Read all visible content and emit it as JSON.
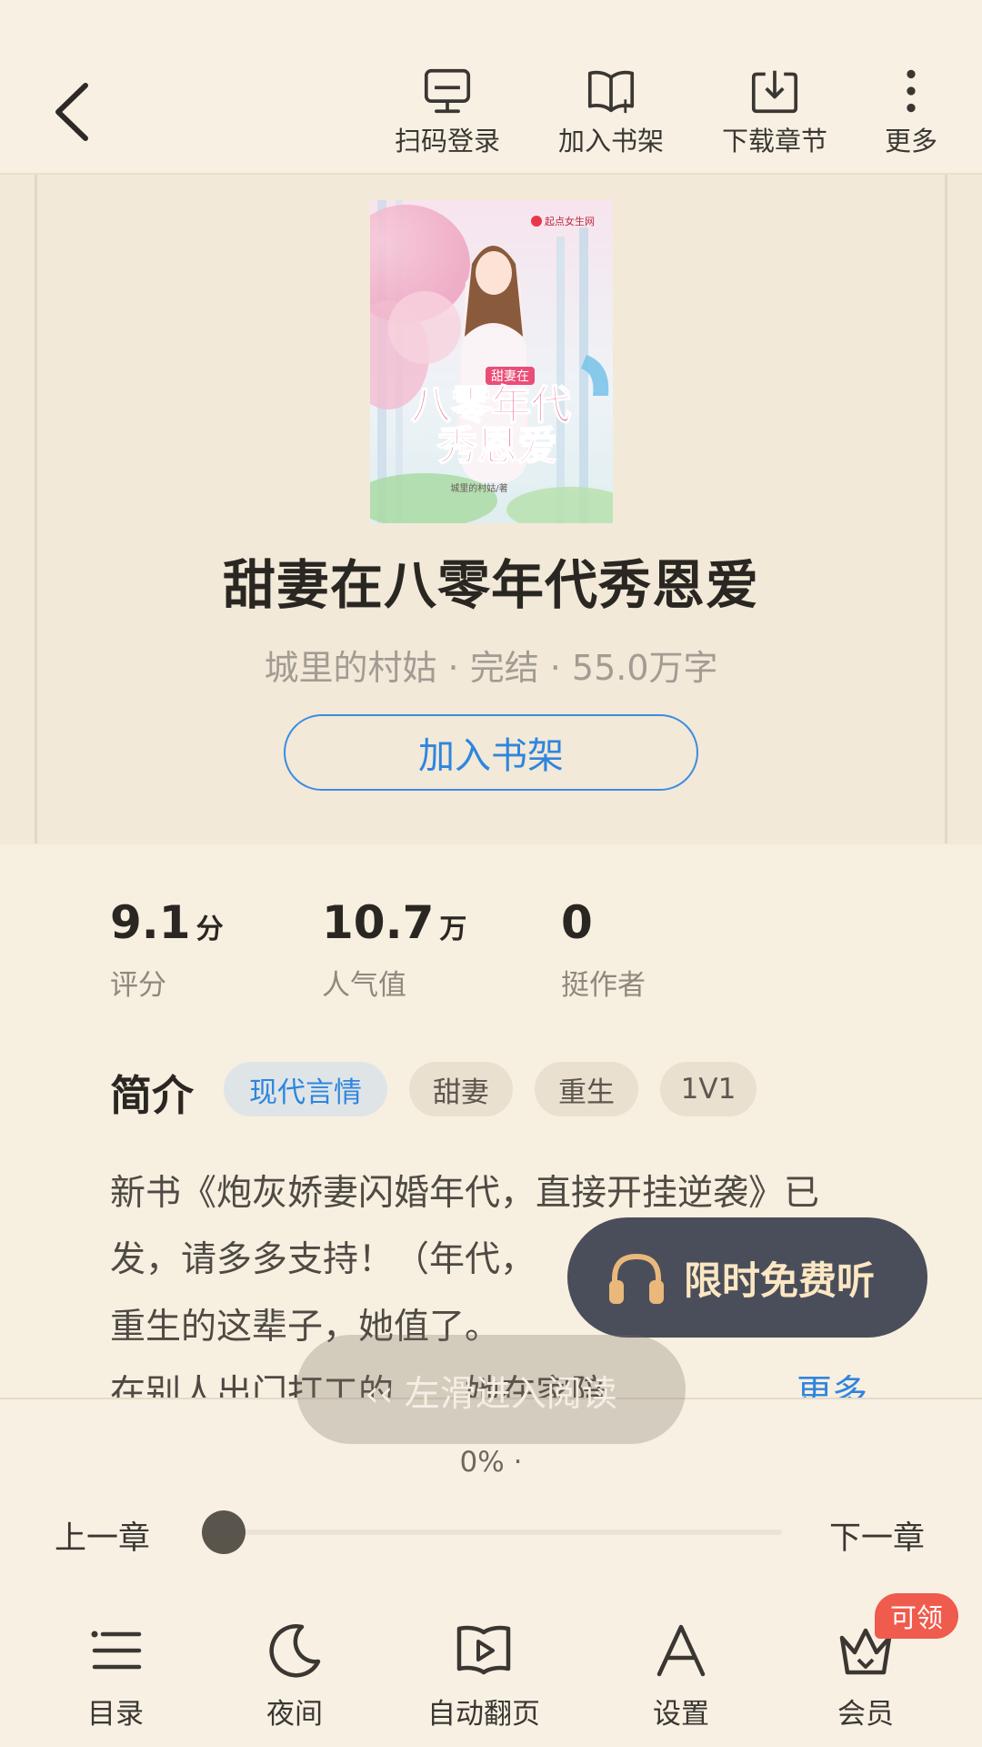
{
  "toolbar": {
    "scan_login": "扫码登录",
    "add_shelf": "加入书架",
    "download": "下载章节",
    "more": "更多"
  },
  "book": {
    "cover_publisher": "起点女生网",
    "cover_subtitle": "甜妻在",
    "cover_title_line1": "八零年代",
    "cover_title_line2": "秀恩爱",
    "cover_author": "城里的村姑/著",
    "title": "甜妻在八零年代秀恩爱",
    "meta": "城里的村姑 · 完结 · 55.0万字",
    "add_shelf_label": "加入书架"
  },
  "stats": [
    {
      "value": "9.1",
      "unit": "分",
      "label": "评分"
    },
    {
      "value": "10.7",
      "unit": "万",
      "label": "人气值"
    },
    {
      "value": "0",
      "unit": "",
      "label": "挺作者"
    }
  ],
  "intro": {
    "heading": "简介",
    "tags": [
      "现代言情",
      "甜妻",
      "重生",
      "1V1"
    ],
    "lines": [
      "新书《炮灰娇妻闪婚年代，直接开挂逆袭》已",
      "发，请多多支持！（年代，",
      "重生的这辈子，她值了。",
      "在别人出门打工的……她在家陪..."
    ],
    "more": "更多"
  },
  "overlays": {
    "free_listen": "限时免费听",
    "swipe_hint": "‹‹ 左滑进入阅读"
  },
  "reader": {
    "progress": "0% ·",
    "progress_value": 0,
    "prev": "上一章",
    "next": "下一章"
  },
  "bottom_nav": {
    "toc": "目录",
    "night": "夜间",
    "auto_page": "自动翻页",
    "settings": "设置",
    "vip": "会员",
    "vip_badge": "可领"
  }
}
